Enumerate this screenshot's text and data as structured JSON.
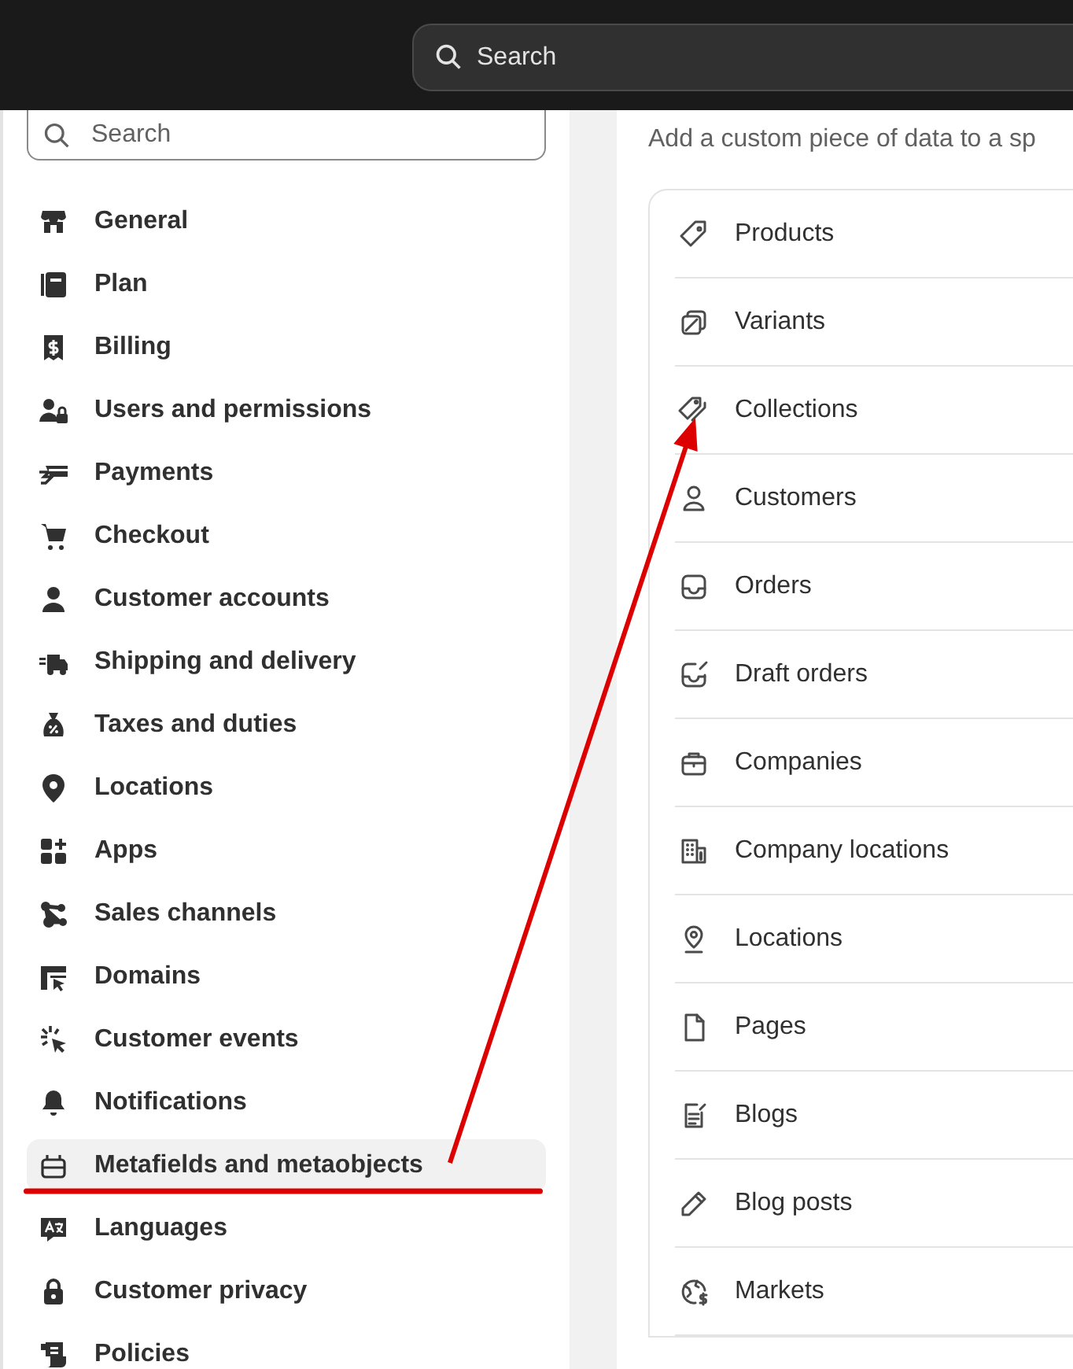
{
  "top_bar": {
    "search": {
      "placeholder": "Search"
    }
  },
  "sidebar": {
    "search": {
      "placeholder": "Search"
    },
    "items": [
      {
        "label": "General",
        "selected": false
      },
      {
        "label": "Plan",
        "selected": false
      },
      {
        "label": "Billing",
        "selected": false
      },
      {
        "label": "Users and permissions",
        "selected": false
      },
      {
        "label": "Payments",
        "selected": false
      },
      {
        "label": "Checkout",
        "selected": false
      },
      {
        "label": "Customer accounts",
        "selected": false
      },
      {
        "label": "Shipping and delivery",
        "selected": false
      },
      {
        "label": "Taxes and duties",
        "selected": false
      },
      {
        "label": "Locations",
        "selected": false
      },
      {
        "label": "Apps",
        "selected": false
      },
      {
        "label": "Sales channels",
        "selected": false
      },
      {
        "label": "Domains",
        "selected": false
      },
      {
        "label": "Customer events",
        "selected": false
      },
      {
        "label": "Notifications",
        "selected": false
      },
      {
        "label": "Metafields and metaobjects",
        "selected": true,
        "marked": true
      },
      {
        "label": "Languages",
        "selected": false
      },
      {
        "label": "Customer privacy",
        "selected": false
      },
      {
        "label": "Policies",
        "selected": false
      }
    ]
  },
  "content": {
    "subtitle": "Add a custom piece of data to a sp",
    "items": [
      {
        "label": "Products"
      },
      {
        "label": "Variants"
      },
      {
        "label": "Collections",
        "pointed_at": true
      },
      {
        "label": "Customers"
      },
      {
        "label": "Orders"
      },
      {
        "label": "Draft orders"
      },
      {
        "label": "Companies"
      },
      {
        "label": "Company locations"
      },
      {
        "label": "Locations"
      },
      {
        "label": "Pages"
      },
      {
        "label": "Blogs"
      },
      {
        "label": "Blog posts"
      },
      {
        "label": "Markets"
      }
    ]
  },
  "annotations": {
    "color": "#dd0000"
  }
}
